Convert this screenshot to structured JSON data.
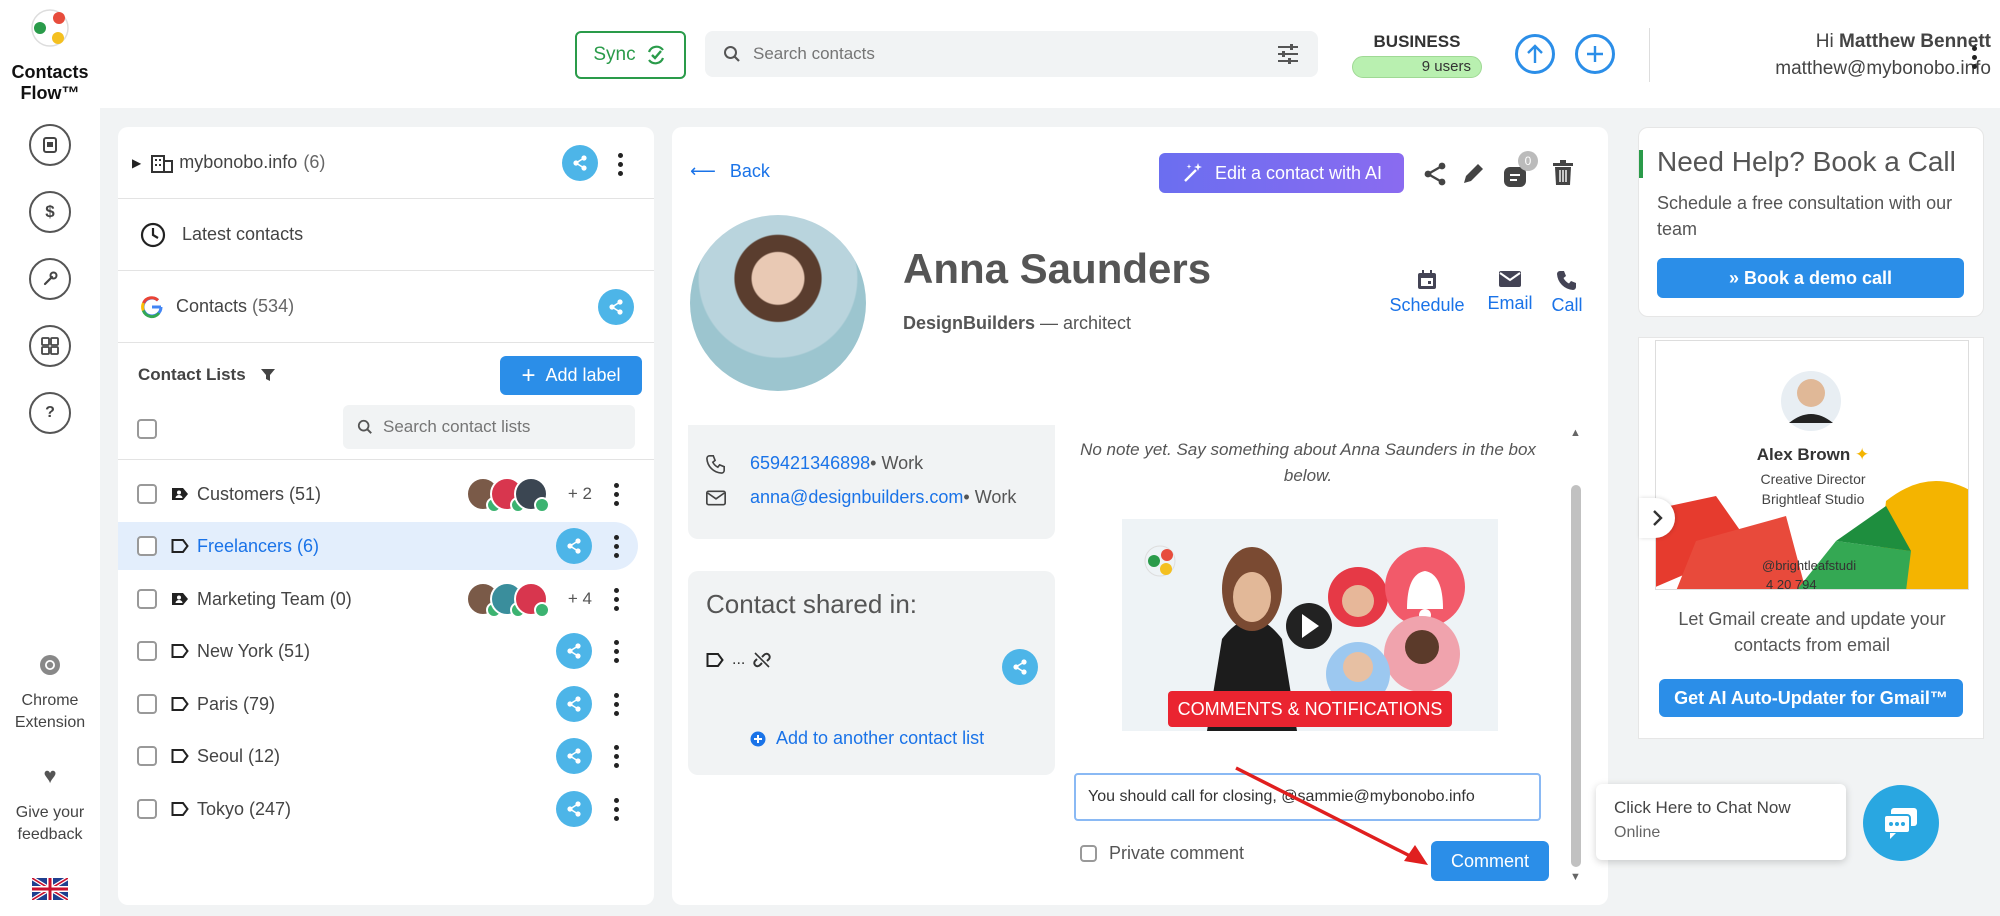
{
  "app": {
    "name_line1": "Contacts",
    "name_line2": "Flow™"
  },
  "rail": {
    "items": [
      {
        "icon": "contacts-book-icon",
        "glyph": "B"
      },
      {
        "icon": "billing-icon",
        "glyph": "$"
      },
      {
        "icon": "wrench-icon",
        "glyph": "⚒"
      },
      {
        "icon": "apps-grid-icon",
        "glyph": "▦"
      },
      {
        "icon": "help-icon",
        "glyph": "?"
      }
    ],
    "chrome_ext_label": "Chrome Extension",
    "feedback_label": "Give your feedback",
    "language_flag": "uk-flag-icon"
  },
  "header": {
    "sync_label": "Sync",
    "search_placeholder": "Search contacts",
    "plan_name": "BUSINESS",
    "plan_users": "9 users",
    "greeting": "Hi",
    "user_name": "Matthew Bennett",
    "user_email": "matthew@mybonobo.info"
  },
  "left": {
    "domain_label": "mybonobo.info",
    "domain_count": "(6)",
    "latest_label": "Latest contacts",
    "contacts_label": "Contacts",
    "contacts_count": "(534)",
    "lists_title": "Contact Lists",
    "add_label_btn": "Add label",
    "search_lists_placeholder": "Search contact lists",
    "lists": [
      {
        "label": "Customers (51)",
        "type": "shared",
        "extra": "+ 2",
        "selected": false
      },
      {
        "label": "Freelancers (6)",
        "type": "label",
        "extra": "",
        "selected": true
      },
      {
        "label": "Marketing Team (0)",
        "type": "shared",
        "extra": "+ 4",
        "selected": false
      },
      {
        "label": "New York (51)",
        "type": "label",
        "extra": "",
        "selected": false
      },
      {
        "label": "Paris (79)",
        "type": "label",
        "extra": "",
        "selected": false
      },
      {
        "label": "Seoul (12)",
        "type": "label",
        "extra": "",
        "selected": false
      },
      {
        "label": "Tokyo (247)",
        "type": "label",
        "extra": "",
        "selected": false
      }
    ]
  },
  "contact": {
    "back_label": "Back",
    "ai_btn_label": "Edit a contact with AI",
    "notes_badge": "0",
    "name": "Anna Saunders",
    "company": "DesignBuilders",
    "title_sep": " — architect",
    "actions": {
      "schedule": "Schedule",
      "email": "Email",
      "call": "Call"
    },
    "phone": "659421346898",
    "phone_type": " • Work",
    "email": "anna@designbuilders.com",
    "email_type": " • Work",
    "shared_in_title": "Contact shared in:",
    "shared_in_item": "...",
    "add_to_list": "Add to another contact list",
    "no_note": "No note yet. Say something about Anna Saunders in the box below.",
    "video_banner": "COMMENTS & NOTIFICATIONS",
    "comment_value": "You should call for closing, @sammie@mybonobo.info",
    "private_label": "Private comment",
    "comment_btn": "Comment"
  },
  "right": {
    "help_title": "Need Help? Book a Call",
    "help_desc": "Schedule a free consultation with our team",
    "book_btn": "» Book a demo call",
    "card_name": "Alex Brown",
    "card_role": "Creative Director",
    "card_company": "Brightleaf Studio",
    "card_partial1": "@brightleafstudi",
    "card_partial2": "4 20 794",
    "gmail_desc": "Let Gmail create and update your contacts from email",
    "gmail_btn": "Get AI Auto-Updater for Gmail™"
  },
  "chat": {
    "title": "Click Here to Chat Now",
    "status": "Online"
  },
  "colors": {
    "accent": "#2b8ee8",
    "share": "#4db5e8",
    "sync_green": "#2a9b4a",
    "ai_purple": "#7a6cf0"
  }
}
